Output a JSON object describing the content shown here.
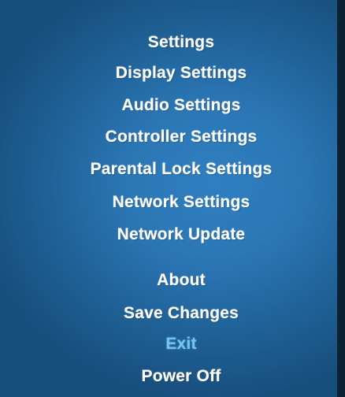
{
  "menu": {
    "title": "Settings",
    "items": [
      {
        "label": "Display Settings"
      },
      {
        "label": "Audio Settings"
      },
      {
        "label": "Controller Settings"
      },
      {
        "label": "Parental Lock Settings"
      },
      {
        "label": "Network Settings"
      },
      {
        "label": "Network Update"
      },
      {
        "label": "About"
      },
      {
        "label": "Save Changes"
      },
      {
        "label": "Exit",
        "selected": true
      },
      {
        "label": "Power Off"
      }
    ],
    "selected_color": "#74c6f0",
    "text_color": "#ffffff"
  }
}
